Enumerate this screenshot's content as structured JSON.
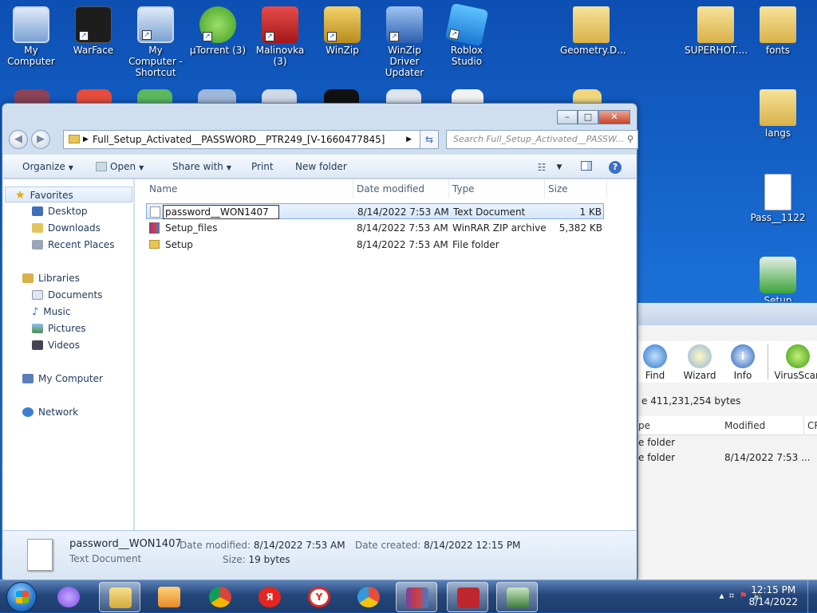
{
  "desktop": {
    "icons": [
      {
        "label": "My Computer",
        "icon": "computer-icon"
      },
      {
        "label": "WarFace",
        "icon": "warface-icon"
      },
      {
        "label": "My Computer - Shortcut",
        "icon": "computer-icon"
      },
      {
        "label": "µTorrent (3)",
        "icon": "utorrent-icon"
      },
      {
        "label": "Malinovka (3)",
        "icon": "malinovka-icon"
      },
      {
        "label": "WinZip",
        "icon": "winzip-icon"
      },
      {
        "label": "WinZip Driver Updater",
        "icon": "winzip-driver-updater-icon"
      },
      {
        "label": "Roblox Studio",
        "icon": "roblox-icon"
      },
      {
        "label": "Geometry.D...",
        "icon": "folder-icon"
      },
      {
        "label": "SUPERHOT....",
        "icon": "folder-icon"
      },
      {
        "label": "fonts",
        "icon": "folder-icon"
      },
      {
        "label": "langs",
        "icon": "folder-icon"
      },
      {
        "label": "Pass__1122",
        "icon": "text-file-icon"
      },
      {
        "label": "Setup",
        "icon": "setup-icon"
      }
    ]
  },
  "explorer": {
    "address_path": "Full_Setup_Activated__PASSWORD__PTR249_[V-1660477845]",
    "search_placeholder": "Search Full_Setup_Activated__PASSW...",
    "caption": {
      "minimize": "–",
      "maximize": "□",
      "close": "✕"
    },
    "toolbar": {
      "organize": "Organize",
      "open": "Open",
      "share_with": "Share with",
      "print": "Print",
      "new_folder": "New folder",
      "help": "?"
    },
    "nav": {
      "favorites": "Favorites",
      "desktop": "Desktop",
      "downloads": "Downloads",
      "recent_places": "Recent Places",
      "libraries": "Libraries",
      "documents": "Documents",
      "music": "Music",
      "pictures": "Pictures",
      "videos": "Videos",
      "my_computer": "My Computer",
      "network": "Network"
    },
    "columns": {
      "name": "Name",
      "date_modified": "Date modified",
      "type": "Type",
      "size": "Size"
    },
    "files": [
      {
        "name": "password__WON1407",
        "date": "8/14/2022 7:53 AM",
        "type": "Text Document",
        "size": "1 KB"
      },
      {
        "name": "Setup_files",
        "date": "8/14/2022 7:53 AM",
        "type": "WinRAR ZIP archive",
        "size": "5,382 KB"
      },
      {
        "name": "Setup",
        "date": "8/14/2022 7:53 AM",
        "type": "File folder",
        "size": ""
      }
    ],
    "details": {
      "name": "password__WON1407",
      "type": "Text Document",
      "date_modified_label": "Date modified:",
      "date_modified": "8/14/2022 7:53 AM",
      "date_created_label": "Date created:",
      "date_created": "8/14/2022 12:15 PM",
      "size_label": "Size:",
      "size": "19 bytes"
    }
  },
  "winzip": {
    "buttons": {
      "find": "Find",
      "wizard": "Wizard",
      "info": "Info",
      "virusscan": "VirusScan"
    },
    "info_text": "e 411,231,254 bytes",
    "headers": {
      "type": "pe",
      "modified": "Modified",
      "crc": "CR"
    },
    "rows": [
      {
        "type": "e folder",
        "modified": ""
      },
      {
        "type": "e folder",
        "modified": "8/14/2022 7:53 ..."
      }
    ]
  },
  "taskbar": {
    "clock_time": "12:15 PM",
    "clock_date": "8/14/2022"
  },
  "colors": {
    "accent": "#3c6fc6",
    "desktop": "#1a6ed4"
  }
}
